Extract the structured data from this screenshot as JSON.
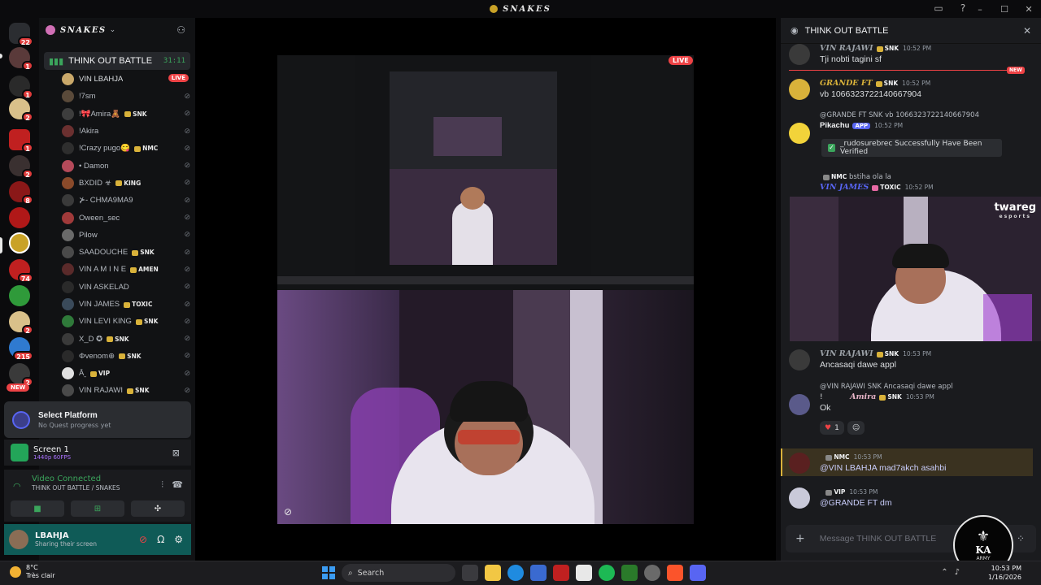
{
  "window": {
    "title": "SNAKES"
  },
  "server_rail": {
    "badges": [
      "22",
      "1",
      "1",
      "2",
      "1",
      "2",
      "8",
      "74",
      "2",
      "215",
      "2"
    ],
    "new_label": "NEW"
  },
  "guild": {
    "name": "SNAKES",
    "chevron": "⌄"
  },
  "voice_channel": {
    "name": "THINK OUT BATTLE",
    "time": "31:11"
  },
  "members": [
    {
      "name": "VIN LBAHJA",
      "tag": "",
      "live": "LIVE",
      "color": "#c9a86a"
    },
    {
      "name": "!7sm",
      "tag": "",
      "live": "",
      "color": "#5a4a3a"
    },
    {
      "name": "!🎀Amira🧸",
      "tag": "SNK",
      "live": "",
      "color": "#3d3d3d"
    },
    {
      "name": "!Akira",
      "tag": "",
      "live": "",
      "color": "#6b3030"
    },
    {
      "name": "!Crazy pugo😋",
      "tag": "NMC",
      "live": "",
      "color": "#2e2e2e"
    },
    {
      "name": "• Damon",
      "tag": "",
      "live": "",
      "color": "#b54a5a"
    },
    {
      "name": "BXDID ☣",
      "tag": "KING",
      "live": "",
      "color": "#8a4a2a"
    },
    {
      "name": "⊁- CHMA9MA9",
      "tag": "",
      "live": "",
      "color": "#3a3a3a"
    },
    {
      "name": "Oween_sec",
      "tag": "",
      "live": "",
      "color": "#a03a3a"
    },
    {
      "name": "Pilow",
      "tag": "",
      "live": "",
      "color": "#6a6a6a"
    },
    {
      "name": "SAADOUCHE",
      "tag": "SNK",
      "live": "",
      "color": "#4a4a4a"
    },
    {
      "name": "VIN A M I N E",
      "tag": "AMEN",
      "live": "",
      "color": "#5a2a2a"
    },
    {
      "name": "VIN ASKELAD",
      "tag": "",
      "live": "",
      "color": "#2a2a2a"
    },
    {
      "name": "VIN JAMES",
      "tag": "TOXIC",
      "live": "",
      "color": "#3a4a5a"
    },
    {
      "name": "VIN LEVI KING",
      "tag": "SNK",
      "live": "",
      "color": "#2f7a3a"
    },
    {
      "name": "X_D ✪",
      "tag": "SNK",
      "live": "",
      "color": "#3a3a3a"
    },
    {
      "name": "Φvenom⊕",
      "tag": "SNK",
      "live": "",
      "color": "#2a2a2a"
    },
    {
      "name": "Ā ̲",
      "tag": "VIP",
      "live": "",
      "color": "#e0e0e0"
    },
    {
      "name": "VIN RAJAWI",
      "tag": "SNK",
      "live": "",
      "color": "#4a4a4a"
    }
  ],
  "quest": {
    "title": "Select Platform",
    "subtitle": "No Quest progress yet"
  },
  "screen_share": {
    "title": "Screen 1",
    "quality": "1440p 60FPS"
  },
  "voice_status": {
    "title": "Video Connected",
    "subtitle": "THINK OUT BATTLE / SNAKES"
  },
  "user": {
    "name": "LBAHJA",
    "status": "Sharing their screen"
  },
  "stage": {
    "live_label": "LIVE"
  },
  "chat": {
    "channel": "THINK OUT BATTLE",
    "new_label": "NEW",
    "placeholder": "Message THINK OUT BATTLE",
    "messages": [
      {
        "author": "VIN RAJAWI",
        "tag": "SNK",
        "time": "10:52 PM",
        "body": "Tji nobti tagini sf",
        "color": "#9aa0a6"
      },
      {
        "author": "GRANDE FT",
        "tag": "SNK",
        "time": "10:52 PM",
        "body": "vb 1066323722140667904",
        "color": "#d9b23a"
      },
      {
        "author": "Pikachu",
        "reply": "@GRANDE FT  SNK  vb 1066323722140667904",
        "app": "APP",
        "time": "10:52 PM",
        "embed": "_rudosurebrec Successfully Have Been Verified",
        "color": "#f2f3f5"
      },
      {
        "author": "",
        "reply": "bstiha ola la",
        "reply_tag": "NMC",
        "name2": "VIN JAMES",
        "tag": "TOXIC",
        "time": "10:52 PM"
      },
      {
        "author": "VIN RAJAWI",
        "tag": "SNK",
        "time": "10:53 PM",
        "body": "Ancasaqi dawe appl",
        "color": "#9aa0a6"
      },
      {
        "author": "Amira",
        "reply": "@VIN RAJAWI  SNK  Ancasaqi dawe appl",
        "tag": "SNK",
        "time": "10:53 PM",
        "body": "Ok",
        "color": "#e8b5c8",
        "prefix": "!"
      },
      {
        "author": "",
        "tag": "NMC",
        "time": "10:53 PM",
        "body": "@VIN LBAHJA mad7akch asahbi"
      },
      {
        "author": "",
        "tag": "VIP",
        "time": "10:53 PM",
        "body": "@GRANDE FT  dm"
      }
    ],
    "reaction": {
      "emoji": "♥",
      "count": "1"
    },
    "pip_brand": "twareg",
    "pip_sub": "esports"
  },
  "emblem": {
    "letters": "KA",
    "sub": "ARMY"
  },
  "taskbar": {
    "weather_temp": "8°C",
    "weather_desc": "Très clair",
    "search": "Search",
    "time": "10:53 PM",
    "date": "1/16/2026"
  }
}
